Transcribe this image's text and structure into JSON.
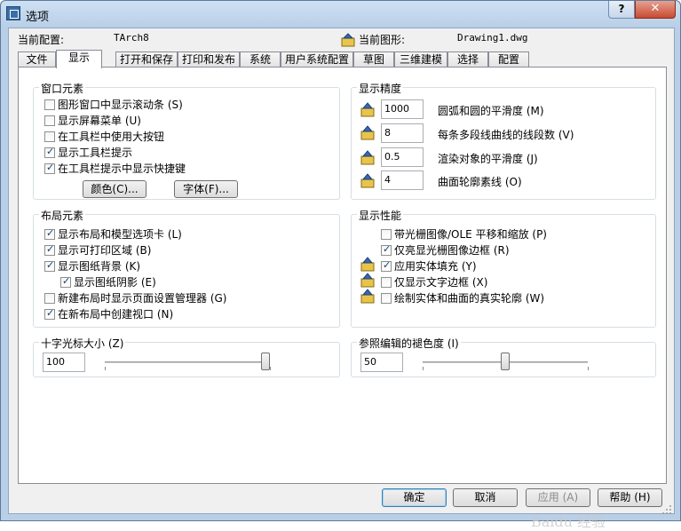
{
  "window": {
    "title": "选项",
    "help": "?",
    "close": "✕"
  },
  "profile": {
    "label": "当前配置:",
    "value": "TArch8"
  },
  "drawing": {
    "label": "当前图形:",
    "value": "Drawing1.dwg"
  },
  "tabs": [
    {
      "label": "文件"
    },
    {
      "label": "显示",
      "active": true
    },
    {
      "label": "打开和保存"
    },
    {
      "label": "打印和发布"
    },
    {
      "label": "系统"
    },
    {
      "label": "用户系统配置"
    },
    {
      "label": "草图"
    },
    {
      "label": "三维建模"
    },
    {
      "label": "选择"
    },
    {
      "label": "配置"
    }
  ],
  "window_elements": {
    "title": "窗口元素",
    "items": [
      {
        "label": "图形窗口中显示滚动条 (S)",
        "checked": false
      },
      {
        "label": "显示屏幕菜单 (U)",
        "checked": false
      },
      {
        "label": "在工具栏中使用大按钮",
        "checked": false
      },
      {
        "label": "显示工具栏提示",
        "checked": true
      },
      {
        "label": "在工具栏提示中显示快捷键",
        "checked": true
      }
    ],
    "color_button": "颜色(C)...",
    "font_button": "字体(F)..."
  },
  "display_resolution": {
    "title": "显示精度",
    "items": [
      {
        "value": "1000",
        "label": "圆弧和圆的平滑度 (M)"
      },
      {
        "value": "8",
        "label": "每条多段线曲线的线段数 (V)"
      },
      {
        "value": "0.5",
        "label": "渲染对象的平滑度 (J)"
      },
      {
        "value": "4",
        "label": "曲面轮廓素线 (O)"
      }
    ]
  },
  "layout_elements": {
    "title": "布局元素",
    "items": [
      {
        "label": "显示布局和模型选项卡 (L)",
        "checked": true
      },
      {
        "label": "显示可打印区域 (B)",
        "checked": true
      },
      {
        "label": "显示图纸背景 (K)",
        "checked": true
      },
      {
        "label": "显示图纸阴影 (E)",
        "checked": true
      },
      {
        "label": "新建布局时显示页面设置管理器 (G)",
        "checked": false
      },
      {
        "label": "在新布局中创建视口 (N)",
        "checked": true
      }
    ]
  },
  "display_performance": {
    "title": "显示性能",
    "items": [
      {
        "label": "带光栅图像/OLE 平移和缩放 (P)",
        "checked": false
      },
      {
        "label": "仅亮显光栅图像边框 (R)",
        "checked": true
      },
      {
        "label": "应用实体填充 (Y)",
        "checked": true
      },
      {
        "label": "仅显示文字边框 (X)",
        "checked": false
      },
      {
        "label": "绘制实体和曲面的真实轮廓 (W)",
        "checked": false
      }
    ]
  },
  "crosshair": {
    "title": "十字光标大小 (Z)",
    "value": "100",
    "level_percent": 100
  },
  "xref_fade": {
    "title": "参照编辑的褪色度 (I)",
    "value": "50",
    "level_percent": 50
  },
  "footer": {
    "ok": "确定",
    "cancel": "取消",
    "apply": "应用 (A)",
    "help": "帮助 (H)"
  },
  "watermark": "Baidu 经验",
  "colors": {
    "titlebar": "#b9cfe6",
    "panel": "#ffffff",
    "dialog": "#f0f0f0",
    "accent": "#3c7fb1"
  }
}
